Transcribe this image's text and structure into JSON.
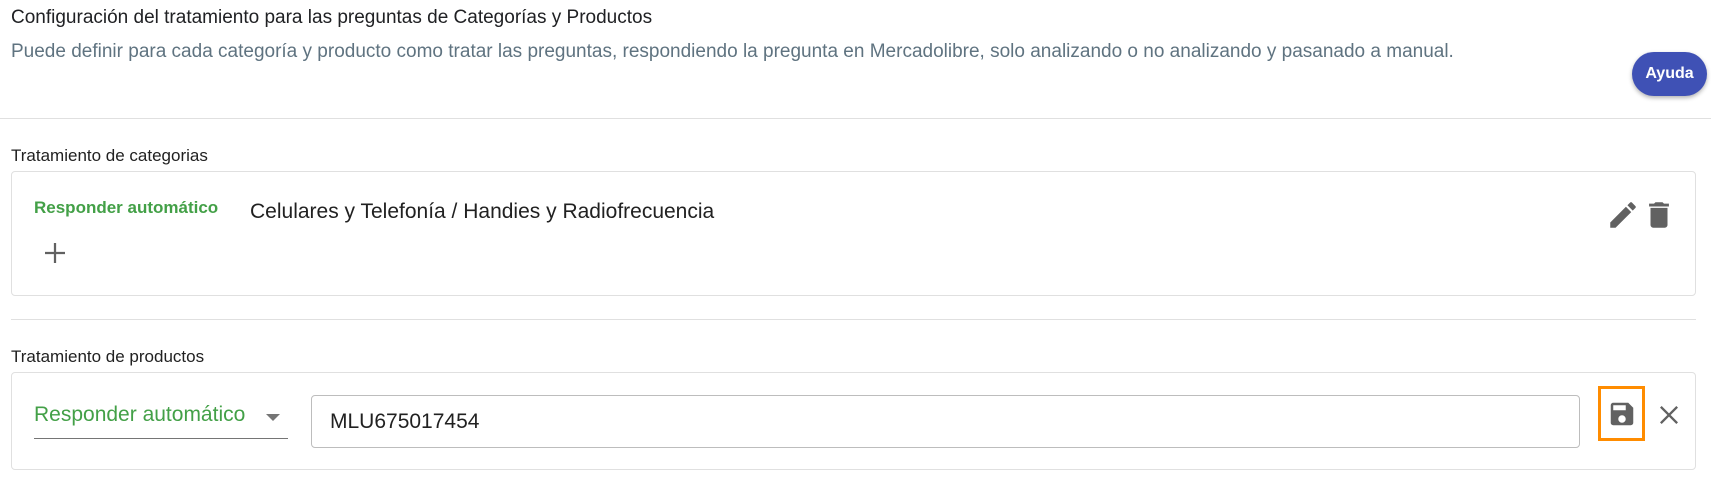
{
  "header": {
    "title": "Configuración del tratamiento para las preguntas de Categorías y Productos",
    "description": "Puede definir para cada categoría y producto como tratar las preguntas, respondiendo la pregunta en Mercadolibre, solo analizando o no analizando y pasanado a manual.",
    "help_label": "Ayuda"
  },
  "categories": {
    "label": "Tratamiento de categorias",
    "items": [
      {
        "mode": "Responder automático",
        "path": "Celulares y Telefonía / Handies y Radiofrecuencia"
      }
    ]
  },
  "products": {
    "label": "Tratamiento de productos",
    "edit_row": {
      "mode": "Responder automático",
      "product_id": "MLU675017454"
    }
  },
  "colors": {
    "accent_green": "#43a047",
    "primary": "#3f51b5",
    "highlight": "#ff8c00"
  },
  "icons": [
    "add-icon",
    "edit-icon",
    "delete-icon",
    "save-icon",
    "close-icon",
    "dropdown-caret-icon"
  ]
}
